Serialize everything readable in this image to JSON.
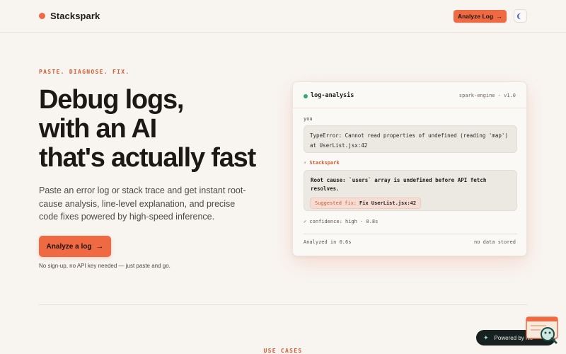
{
  "header": {
    "brand": "Stackspark",
    "cta_label": "Analyze Log",
    "cta_icon": "arrow-right-icon",
    "toggle_icon": "moon-icon"
  },
  "hero": {
    "eyebrow": "PASTE. DIAGNOSE. FIX.",
    "title_lines": [
      "Debug logs,",
      "with an AI",
      "that's actually fast"
    ],
    "description": "Paste an error log or stack trace and get instant root-cause analysis, line-level explanation, and precise code fixes powered by high-speed inference.",
    "cta_label": "Analyze a log",
    "note": "No sign-up, no API key needed — just paste and go."
  },
  "card": {
    "title": "log-analysis",
    "version": "spark-engine · v1.0",
    "user_label": "you",
    "user_message": "TypeError: Cannot read properties of undefined (reading 'map') at UserList.jsx:42",
    "ai_label": "⚡ Stackspark",
    "ai_message": "Root cause: `users` array is undefined before API fetch resolves.",
    "fix_key": "Suggested fix:",
    "fix_value": "Fix UserList.jsx:42",
    "confidence": "✓ confidence: high · 0.8s",
    "footer_left": "Analyzed in 0.6s",
    "footer_right": "no data stored"
  },
  "section": {
    "eyebrow": "USE CASES"
  },
  "badge": {
    "label": "Powered by Ne"
  },
  "colors": {
    "accent": "#ef6a43",
    "background": "#f8f5f1",
    "status_green": "#2fae7a"
  }
}
